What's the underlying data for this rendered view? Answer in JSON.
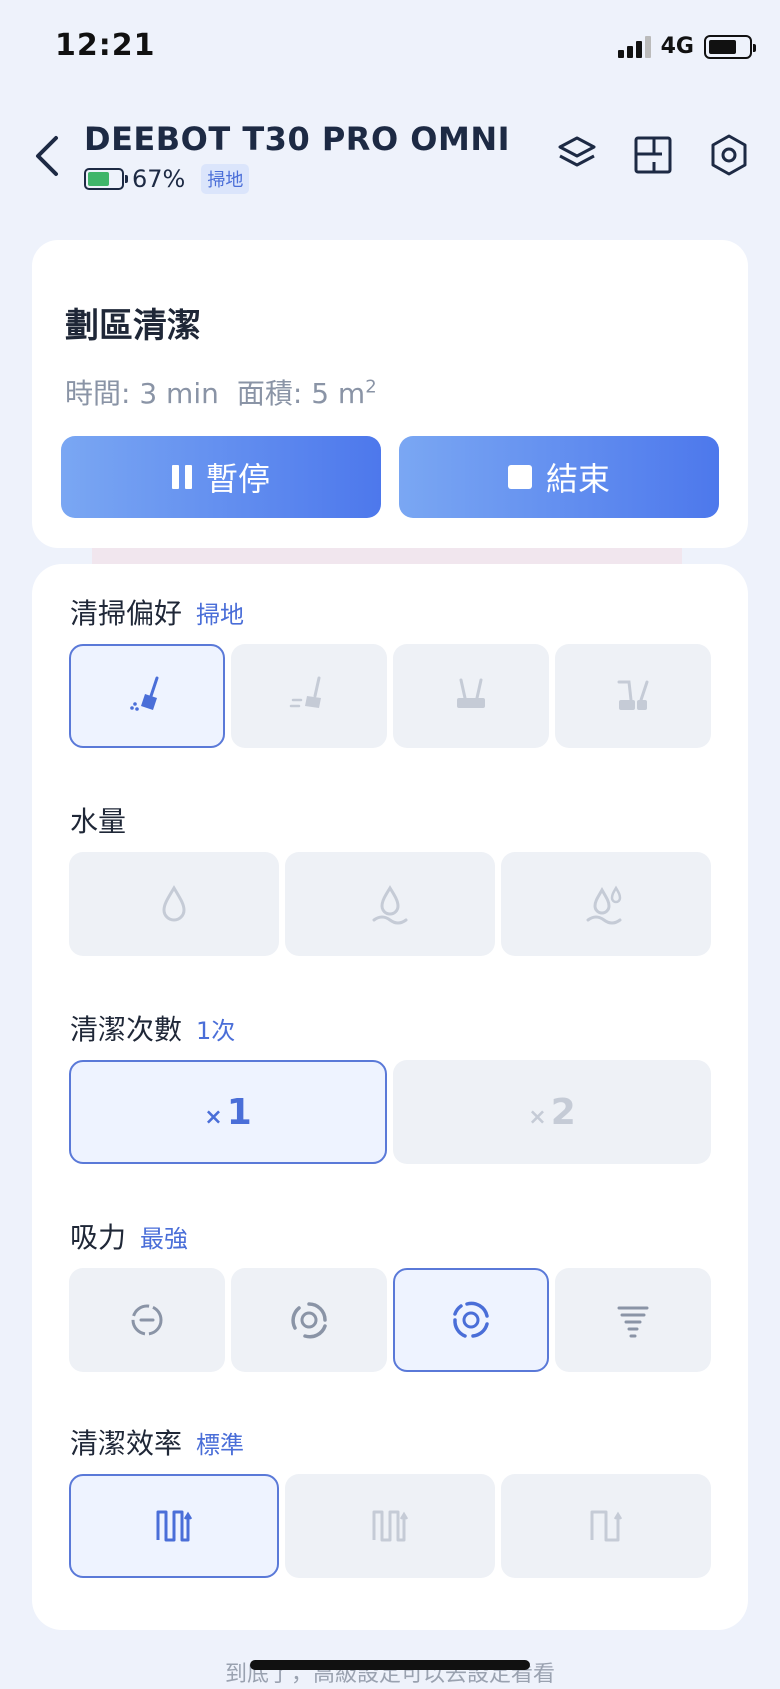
{
  "status": {
    "time": "12:21",
    "network": "4G"
  },
  "header": {
    "title": "DEEBOT T30 PRO OMNI",
    "battery_pct": "67%",
    "battery_level": 0.67,
    "mode_badge": "掃地"
  },
  "task": {
    "name": "劃區清潔",
    "time_label": "時間: 3 min",
    "area_label": "面積: 5 m",
    "area_sup": "2",
    "pause_label": "暫停",
    "stop_label": "結束"
  },
  "settings": {
    "preference": {
      "title": "清掃偏好",
      "value": "掃地",
      "selected_index": 0
    },
    "water": {
      "title": "水量",
      "value": ""
    },
    "passes": {
      "title": "清潔次數",
      "value": "1次",
      "options": [
        "1",
        "2"
      ],
      "prefix": "×",
      "selected_index": 0
    },
    "suction": {
      "title": "吸力",
      "value": "最強",
      "selected_index": 2
    },
    "efficiency": {
      "title": "清潔效率",
      "value": "標準",
      "selected_index": 0
    }
  },
  "footer_hint": "到底了，高級設定可以去設定看看",
  "colors": {
    "accent": "#4a6ed8",
    "selected_border": "#5a79d8",
    "option_bg": "#eef1f6",
    "battery_green": "#3fb56a"
  }
}
